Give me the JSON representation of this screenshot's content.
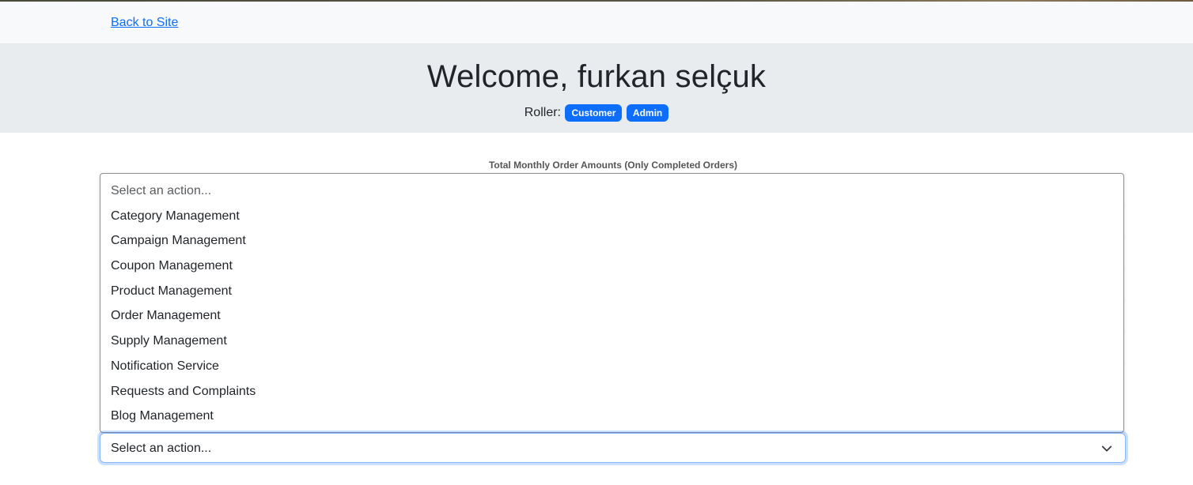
{
  "nav": {
    "back_link": "Back to Site"
  },
  "hero": {
    "title": "Welcome, furkan selçuk",
    "roles_label": "Roller:",
    "roles": [
      "Customer",
      "Admin"
    ]
  },
  "chart": {
    "title": "Total Monthly Order Amounts (Only Completed Orders)"
  },
  "action_select": {
    "placeholder": "Select an action...",
    "selected": "Select an action...",
    "options": [
      "Category Management",
      "Campaign Management",
      "Coupon Management",
      "Product Management",
      "Order Management",
      "Supply Management",
      "Notification Service",
      "Requests and Complaints",
      "Blog Management"
    ]
  },
  "colors": {
    "accent": "#0d6efd",
    "hero_bg": "#e9ecef",
    "navbar_bg": "#f8f9fa"
  },
  "icons": {
    "select_arrow": "chevron-down-icon"
  }
}
